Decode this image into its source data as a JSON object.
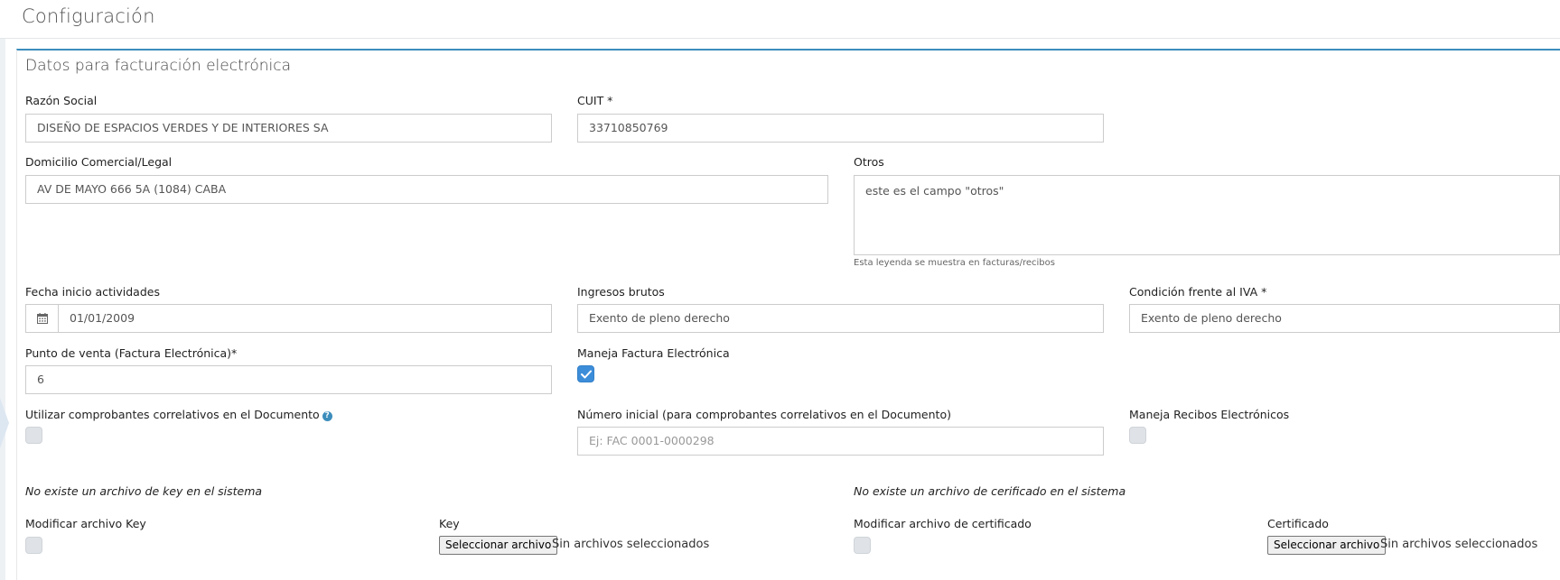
{
  "page": {
    "title": "Configuración"
  },
  "panel": {
    "title": "Datos para facturación electrónica"
  },
  "fields": {
    "razon_social": {
      "label": "Razón Social",
      "value": "DISEÑO DE ESPACIOS VERDES Y DE INTERIORES SA"
    },
    "cuit": {
      "label": "CUIT *",
      "value": "33710850769"
    },
    "domicilio": {
      "label": "Domicilio Comercial/Legal",
      "value": "AV DE MAYO 666 5A (1084) CABA"
    },
    "otros": {
      "label": "Otros",
      "value": "este es el campo \"otros\"",
      "help": "Esta leyenda se muestra en facturas/recibos"
    },
    "fecha_inicio": {
      "label": "Fecha inicio actividades",
      "value": "01/01/2009"
    },
    "ingresos_brutos": {
      "label": "Ingresos brutos",
      "value": "Exento de pleno derecho"
    },
    "condicion_iva": {
      "label": "Condición frente al IVA *",
      "value": "Exento de pleno derecho"
    },
    "punto_venta": {
      "label": "Punto de venta (Factura Electrónica)*",
      "value": "6"
    },
    "maneja_factura": {
      "label": "Maneja Factura Electrónica",
      "checked": true
    },
    "correlativos": {
      "label": "Utilizar comprobantes correlativos en el Documento",
      "checked": false
    },
    "numero_inicial": {
      "label": "Número inicial (para comprobantes correlativos en el Documento)",
      "placeholder": "Ej: FAC 0001-0000298"
    },
    "maneja_recibos": {
      "label": "Maneja Recibos Electrónicos",
      "checked": false
    }
  },
  "files": {
    "key_note": "No existe un archivo de key en el sistema",
    "cert_note": "No existe un archivo de cerificado en el sistema",
    "modificar_key": {
      "label": "Modificar archivo Key",
      "checked": false
    },
    "key": {
      "label": "Key",
      "button": "Seleccionar archivo",
      "status": "Sin archivos seleccionados"
    },
    "modificar_cert": {
      "label": "Modificar archivo de certificado",
      "checked": false
    },
    "certificado": {
      "label": "Certificado",
      "button": "Seleccionar archivo",
      "status": "Sin archivos seleccionados"
    }
  },
  "colors": {
    "accent": "#3c8dbc",
    "checkbox_checked": "#3c8dd9"
  }
}
